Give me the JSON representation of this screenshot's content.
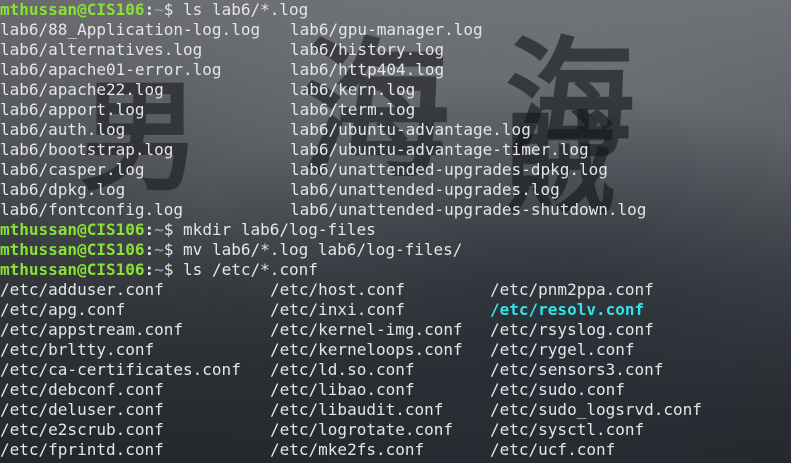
{
  "prompt": {
    "user_host": "mthussan@CIS106",
    "sep": ":",
    "path": "~",
    "symbol": "$ "
  },
  "commands": {
    "c1": "ls lab6/*.log",
    "c2": "mkdir lab6/log-files",
    "c3": "mv lab6/*.log lab6/log-files/",
    "c4": "ls /etc/*.conf"
  },
  "log_listing": [
    [
      "lab6/88_Application-log.log",
      "lab6/gpu-manager.log"
    ],
    [
      "lab6/alternatives.log",
      "lab6/history.log"
    ],
    [
      "lab6/apache01-error.log",
      "lab6/http404.log"
    ],
    [
      "lab6/apache22.log",
      "lab6/kern.log"
    ],
    [
      "lab6/apport.log",
      "lab6/term.log"
    ],
    [
      "lab6/auth.log",
      "lab6/ubuntu-advantage.log"
    ],
    [
      "lab6/bootstrap.log",
      "lab6/ubuntu-advantage-timer.log"
    ],
    [
      "lab6/casper.log",
      "lab6/unattended-upgrades-dpkg.log"
    ],
    [
      "lab6/dpkg.log",
      "lab6/unattended-upgrades.log"
    ],
    [
      "lab6/fontconfig.log",
      "lab6/unattended-upgrades-shutdown.log"
    ]
  ],
  "conf_listing": [
    [
      "/etc/adduser.conf",
      "/etc/host.conf",
      "/etc/pnm2ppa.conf"
    ],
    [
      "/etc/apg.conf",
      "/etc/inxi.conf",
      "/etc/resolv.conf"
    ],
    [
      "/etc/appstream.conf",
      "/etc/kernel-img.conf",
      "/etc/rsyslog.conf"
    ],
    [
      "/etc/brltty.conf",
      "/etc/kerneloops.conf",
      "/etc/rygel.conf"
    ],
    [
      "/etc/ca-certificates.conf",
      "/etc/ld.so.conf",
      "/etc/sensors3.conf"
    ],
    [
      "/etc/debconf.conf",
      "/etc/libao.conf",
      "/etc/sudo.conf"
    ],
    [
      "/etc/deluser.conf",
      "/etc/libaudit.conf",
      "/etc/sudo_logsrvd.conf"
    ],
    [
      "/etc/e2scrub.conf",
      "/etc/logrotate.conf",
      "/etc/sysctl.conf"
    ],
    [
      "/etc/fprintd.conf",
      "/etc/mke2fs.conf",
      "/etc/ucf.conf"
    ]
  ],
  "colors": {
    "prompt_user": "#8ae234",
    "prompt_path": "#729fcf",
    "symlink": "#34e2e2",
    "text": "#e6e6e6"
  }
}
